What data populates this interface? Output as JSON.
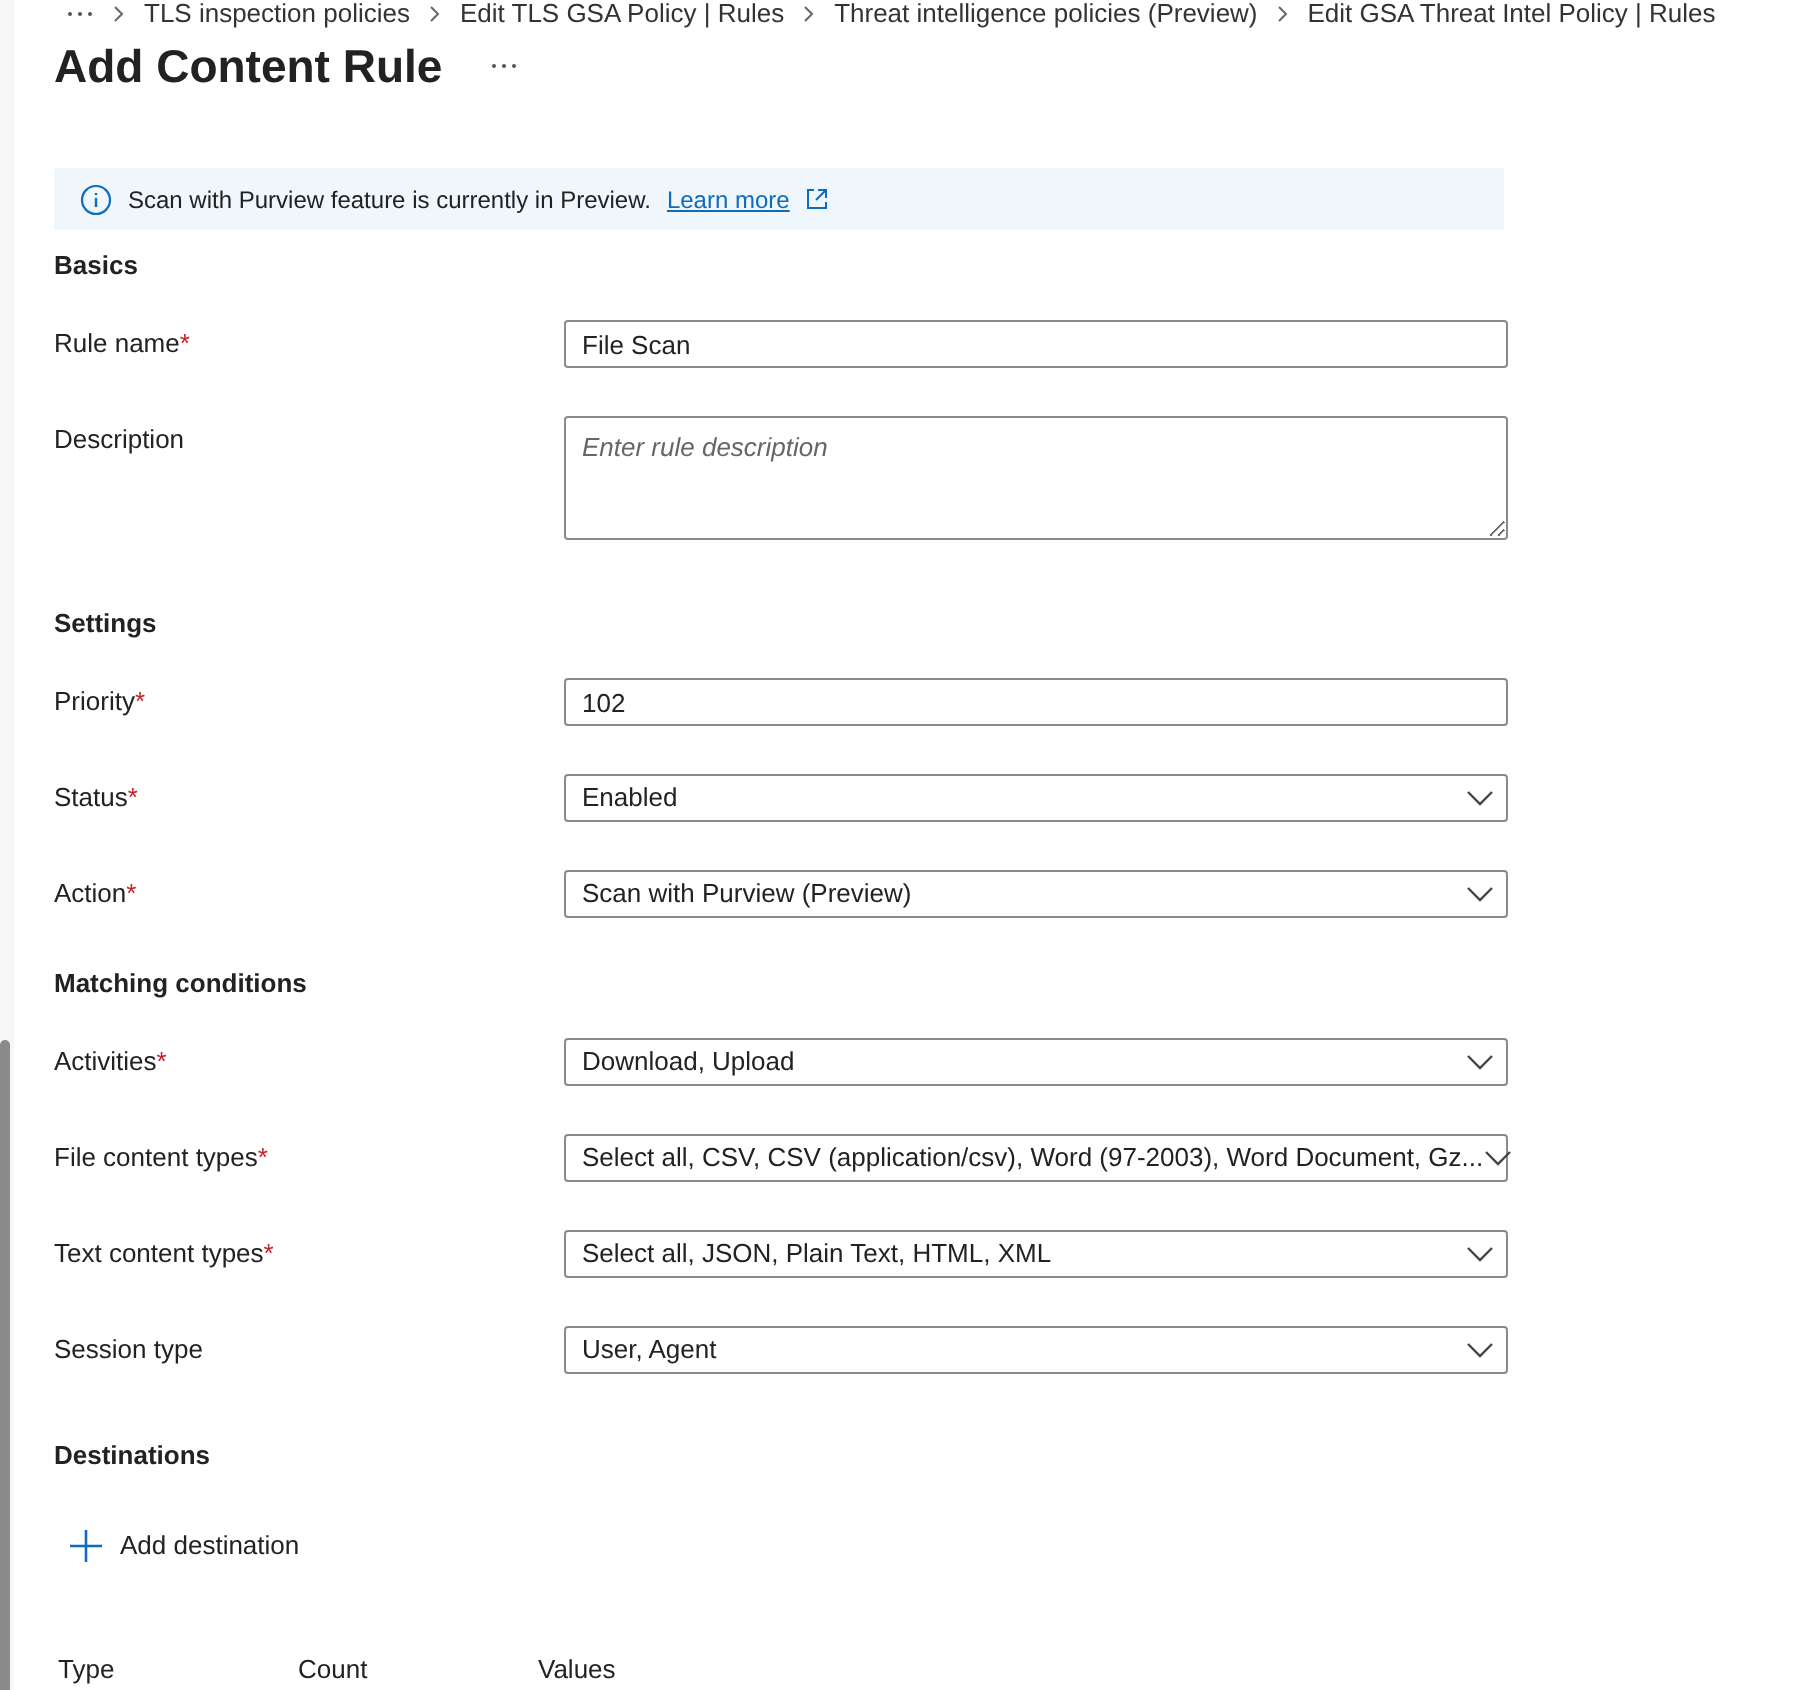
{
  "breadcrumb": [
    "TLS inspection policies",
    "Edit TLS GSA Policy | Rules",
    "Threat intelligence policies (Preview)",
    "Edit GSA Threat Intel Policy | Rules"
  ],
  "title": "Add Content Rule",
  "info_bar": {
    "message": "Scan with Purview feature is currently in Preview.",
    "link": "Learn more"
  },
  "required_mark": "*",
  "sections": [
    {
      "heading": "Basics",
      "fields": [
        {
          "kind": "text",
          "label": "Rule name",
          "required": true,
          "value": "File Scan"
        },
        {
          "kind": "textarea",
          "label": "Description",
          "required": false,
          "placeholder": "Enter rule description"
        }
      ]
    },
    {
      "heading": "Settings",
      "fields": [
        {
          "kind": "text",
          "label": "Priority",
          "required": true,
          "value": "102"
        },
        {
          "kind": "dropdown",
          "label": "Status",
          "required": true,
          "value": "Enabled"
        },
        {
          "kind": "dropdown",
          "label": "Action",
          "required": true,
          "value": "Scan with Purview (Preview)"
        }
      ]
    },
    {
      "heading": "Matching conditions",
      "fields": [
        {
          "kind": "dropdown",
          "label": "Activities",
          "required": true,
          "value": "Download, Upload"
        },
        {
          "kind": "dropdown",
          "label": "File content types",
          "required": true,
          "value": "Select all, CSV, CSV (application/csv), Word (97-2003), Word Document, Gz..."
        },
        {
          "kind": "dropdown",
          "label": "Text content types",
          "required": true,
          "value": "Select all, JSON, Plain Text, HTML, XML"
        },
        {
          "kind": "dropdown",
          "label": "Session type",
          "required": false,
          "value": "User, Agent"
        }
      ]
    }
  ],
  "destinations": {
    "heading": "Destinations",
    "add_button": "Add destination",
    "columns": [
      "Type",
      "Count",
      "Values"
    ]
  }
}
